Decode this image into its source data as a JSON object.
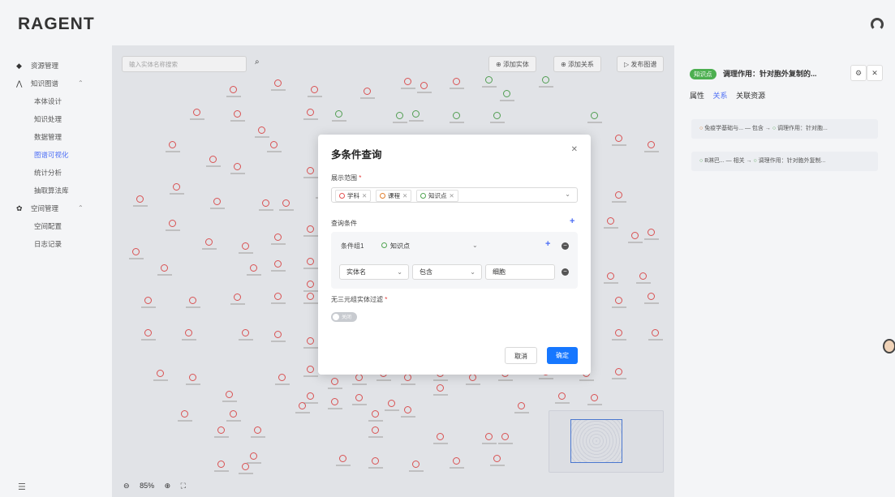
{
  "app": {
    "logo": "RAGENT"
  },
  "sidebar": {
    "items": [
      {
        "label": "资源管理",
        "icon": "database-icon"
      },
      {
        "label": "知识图谱",
        "icon": "graph-icon"
      },
      {
        "label": "本体设计"
      },
      {
        "label": "知识处理"
      },
      {
        "label": "数据管理"
      },
      {
        "label": "图谱可视化",
        "active": true
      },
      {
        "label": "统计分析"
      },
      {
        "label": "抽取算法库"
      },
      {
        "label": "空间管理",
        "icon": "gear-icon"
      },
      {
        "label": "空间配置"
      },
      {
        "label": "日志记录"
      }
    ]
  },
  "canvas": {
    "search_placeholder": "输入实体名称搜索",
    "btn_add_entity": "添加实体",
    "btn_add_relation": "添加关系",
    "btn_publish": "发布图谱",
    "zoom": "85%"
  },
  "right_panel": {
    "tag": "知识点",
    "title": "调理作用：针对胞外复制的...",
    "tabs": [
      "属性",
      "关系",
      "关联资源"
    ],
    "relations": [
      {
        "from": "免疫学基础与...",
        "rel": "包含",
        "to": "调理作用：针对胞..."
      },
      {
        "from": "B淋巴...",
        "rel": "相关",
        "to": "调理作用：针对胞外复制..."
      }
    ]
  },
  "modal": {
    "title": "多条件查询",
    "scope_label": "展示范围",
    "scope_chips": [
      {
        "label": "学科",
        "color": "#e55353"
      },
      {
        "label": "课程",
        "color": "#e08030"
      },
      {
        "label": "知识点",
        "color": "#52a552"
      }
    ],
    "query_label": "查询条件",
    "group": {
      "label": "条件组1",
      "type": "知识点",
      "field": "实体名",
      "operator": "包含",
      "value": "细胞"
    },
    "filter_label": "无三元组实体过滤",
    "toggle_text": "关闭",
    "cancel": "取消",
    "ok": "确定"
  },
  "colors": {
    "primary": "#1677ff",
    "node_red": "#e55353",
    "node_green": "#52a552"
  }
}
